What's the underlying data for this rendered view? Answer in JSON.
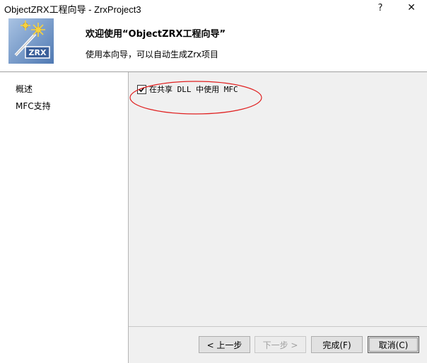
{
  "window": {
    "title": "ObjectZRX工程向导 - ZrxProject3",
    "help_glyph": "?",
    "close_glyph": "✕"
  },
  "header": {
    "title": "欢迎使用“ObjectZRX工程向导”",
    "subtitle": "使用本向导，可以自动生成Zrx项目",
    "icon": "wizard-wand-icon",
    "icon_text": "ZRX"
  },
  "sidebar": {
    "items": [
      {
        "label": "概述"
      },
      {
        "label": "MFC支持"
      }
    ]
  },
  "main": {
    "mfc_option": {
      "label": "在共享 DLL 中使用 MFC",
      "checked": true
    },
    "annotation_color": "#e02020"
  },
  "buttons": {
    "back": "< 上一步",
    "next": "下一步 >",
    "finish": "完成(F)",
    "cancel": "取消(C)"
  }
}
